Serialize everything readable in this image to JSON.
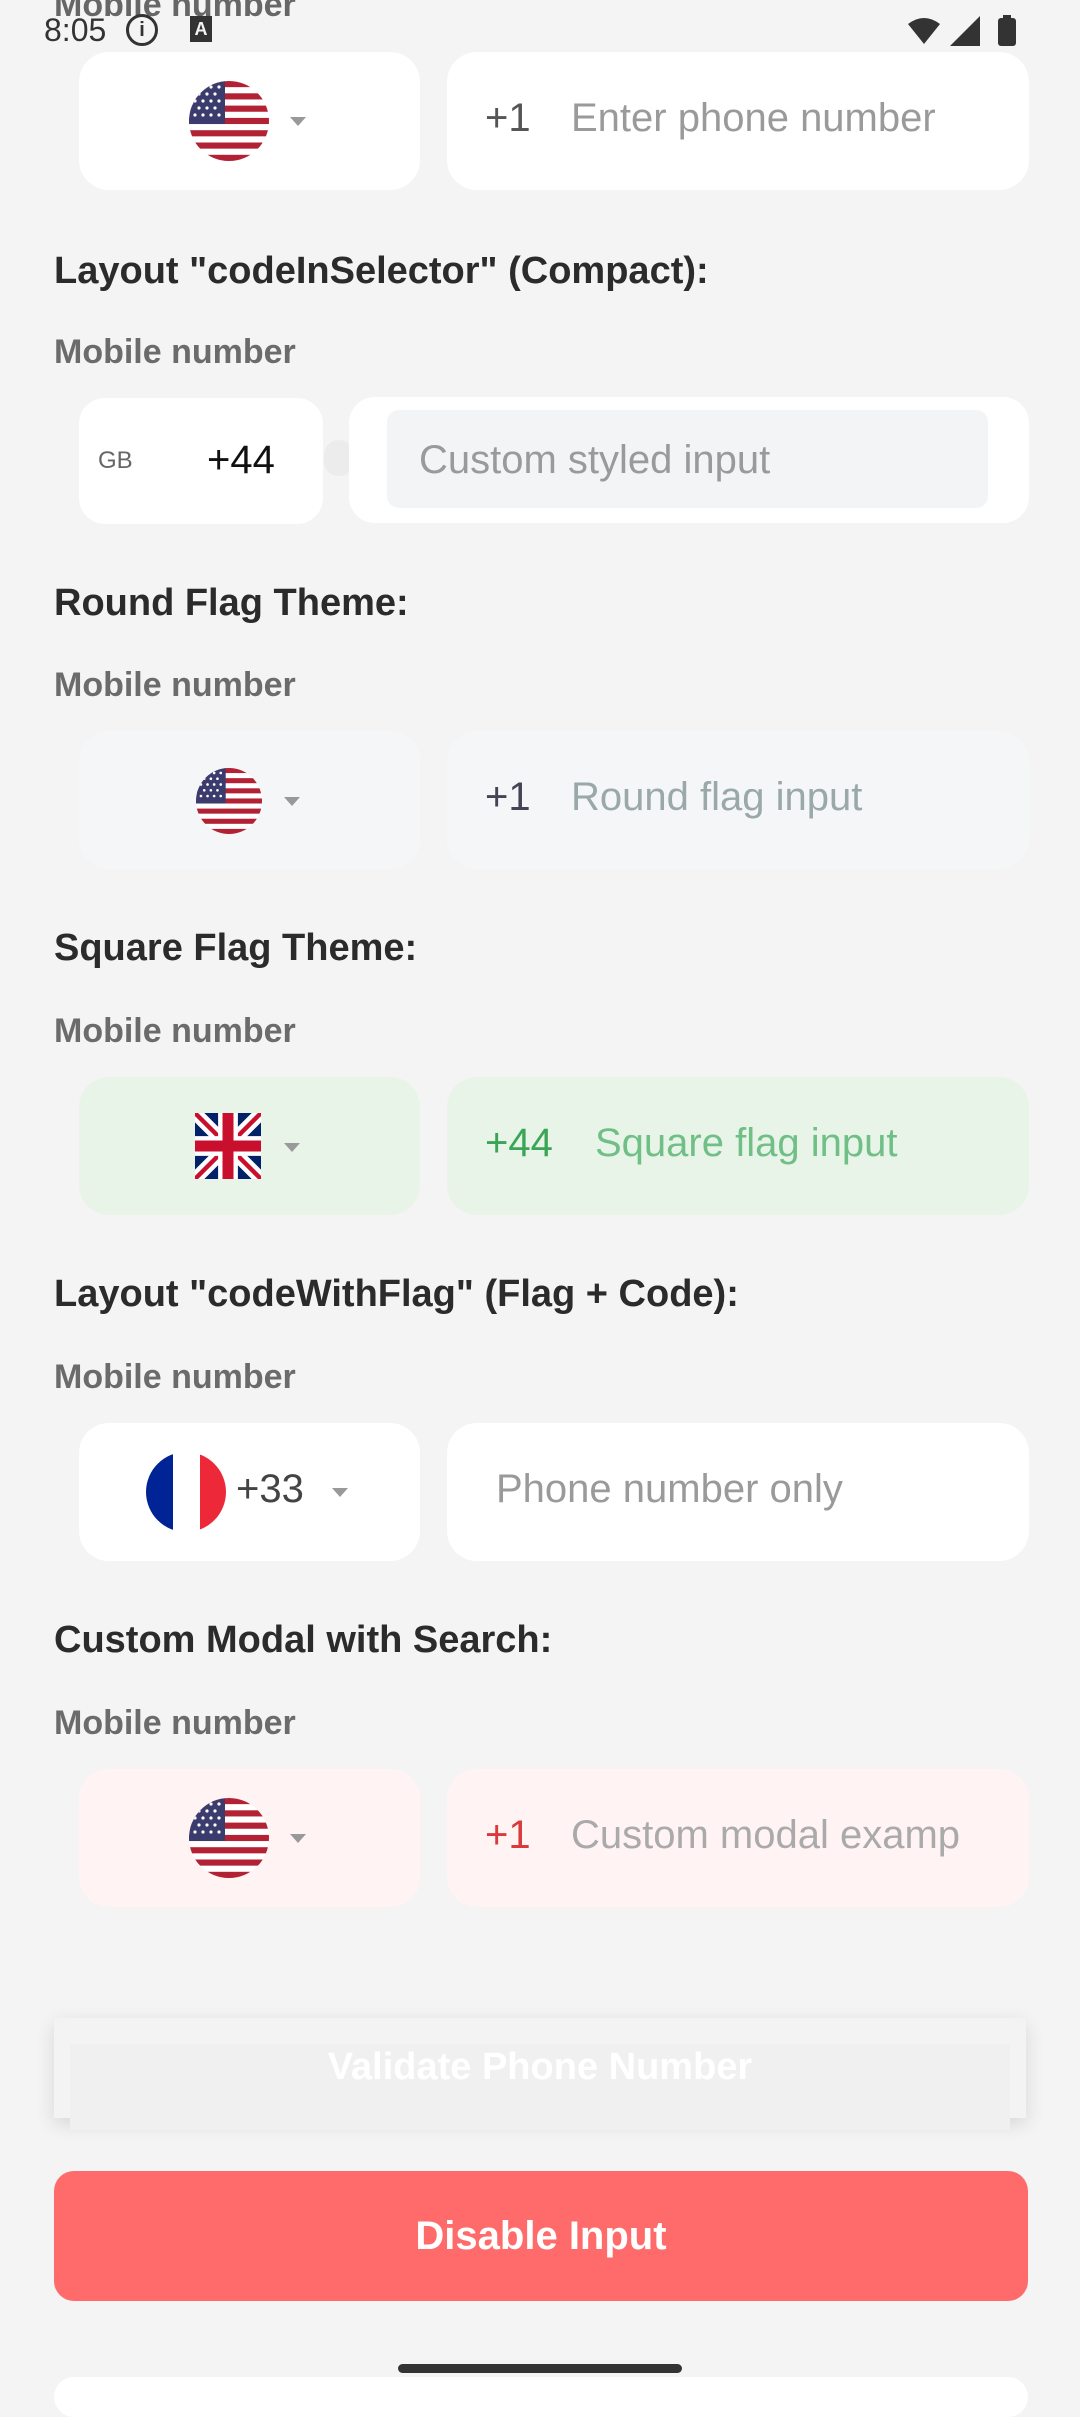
{
  "status_bar": {
    "time": "8:05",
    "a_glyph": "A"
  },
  "top_partial": {
    "label": "Mobile number",
    "dial_code": "+1",
    "placeholder": "Enter phone number"
  },
  "sections": [
    {
      "title": "Layout \"codeInSelector\" (Compact):",
      "label": "Mobile number",
      "country_code": "GB",
      "dial_code": "+44",
      "placeholder": "Custom styled input"
    },
    {
      "title": "Round Flag Theme:",
      "label": "Mobile number",
      "dial_code": "+1",
      "placeholder": "Round flag input"
    },
    {
      "title": "Square Flag Theme:",
      "label": "Mobile number",
      "dial_code": "+44",
      "placeholder": "Square flag input"
    },
    {
      "title": "Layout \"codeWithFlag\" (Flag + Code):",
      "label": "Mobile number",
      "dial_code": "+33",
      "placeholder": "Phone number only"
    },
    {
      "title": "Custom Modal with Search:",
      "label": "Mobile number",
      "dial_code": "+1",
      "placeholder": "Custom modal examp"
    }
  ],
  "buttons": {
    "validate": "Validate Phone Number",
    "disable": "Disable Input"
  },
  "icons": {
    "flag_us": "us-flag-icon",
    "flag_gb": "gb-flag-icon",
    "flag_fr": "fr-flag-icon",
    "caret": "caret-down-icon"
  },
  "colors": {
    "background": "#f4f4f4",
    "square_theme_bg": "#e8f4e8",
    "square_theme_text": "#3aa556",
    "round_theme_bg": "#f5f6f8",
    "modal_theme_bg": "#fff4f3",
    "modal_theme_text": "#d93a3a",
    "disable_button": "#ff6b6b"
  }
}
